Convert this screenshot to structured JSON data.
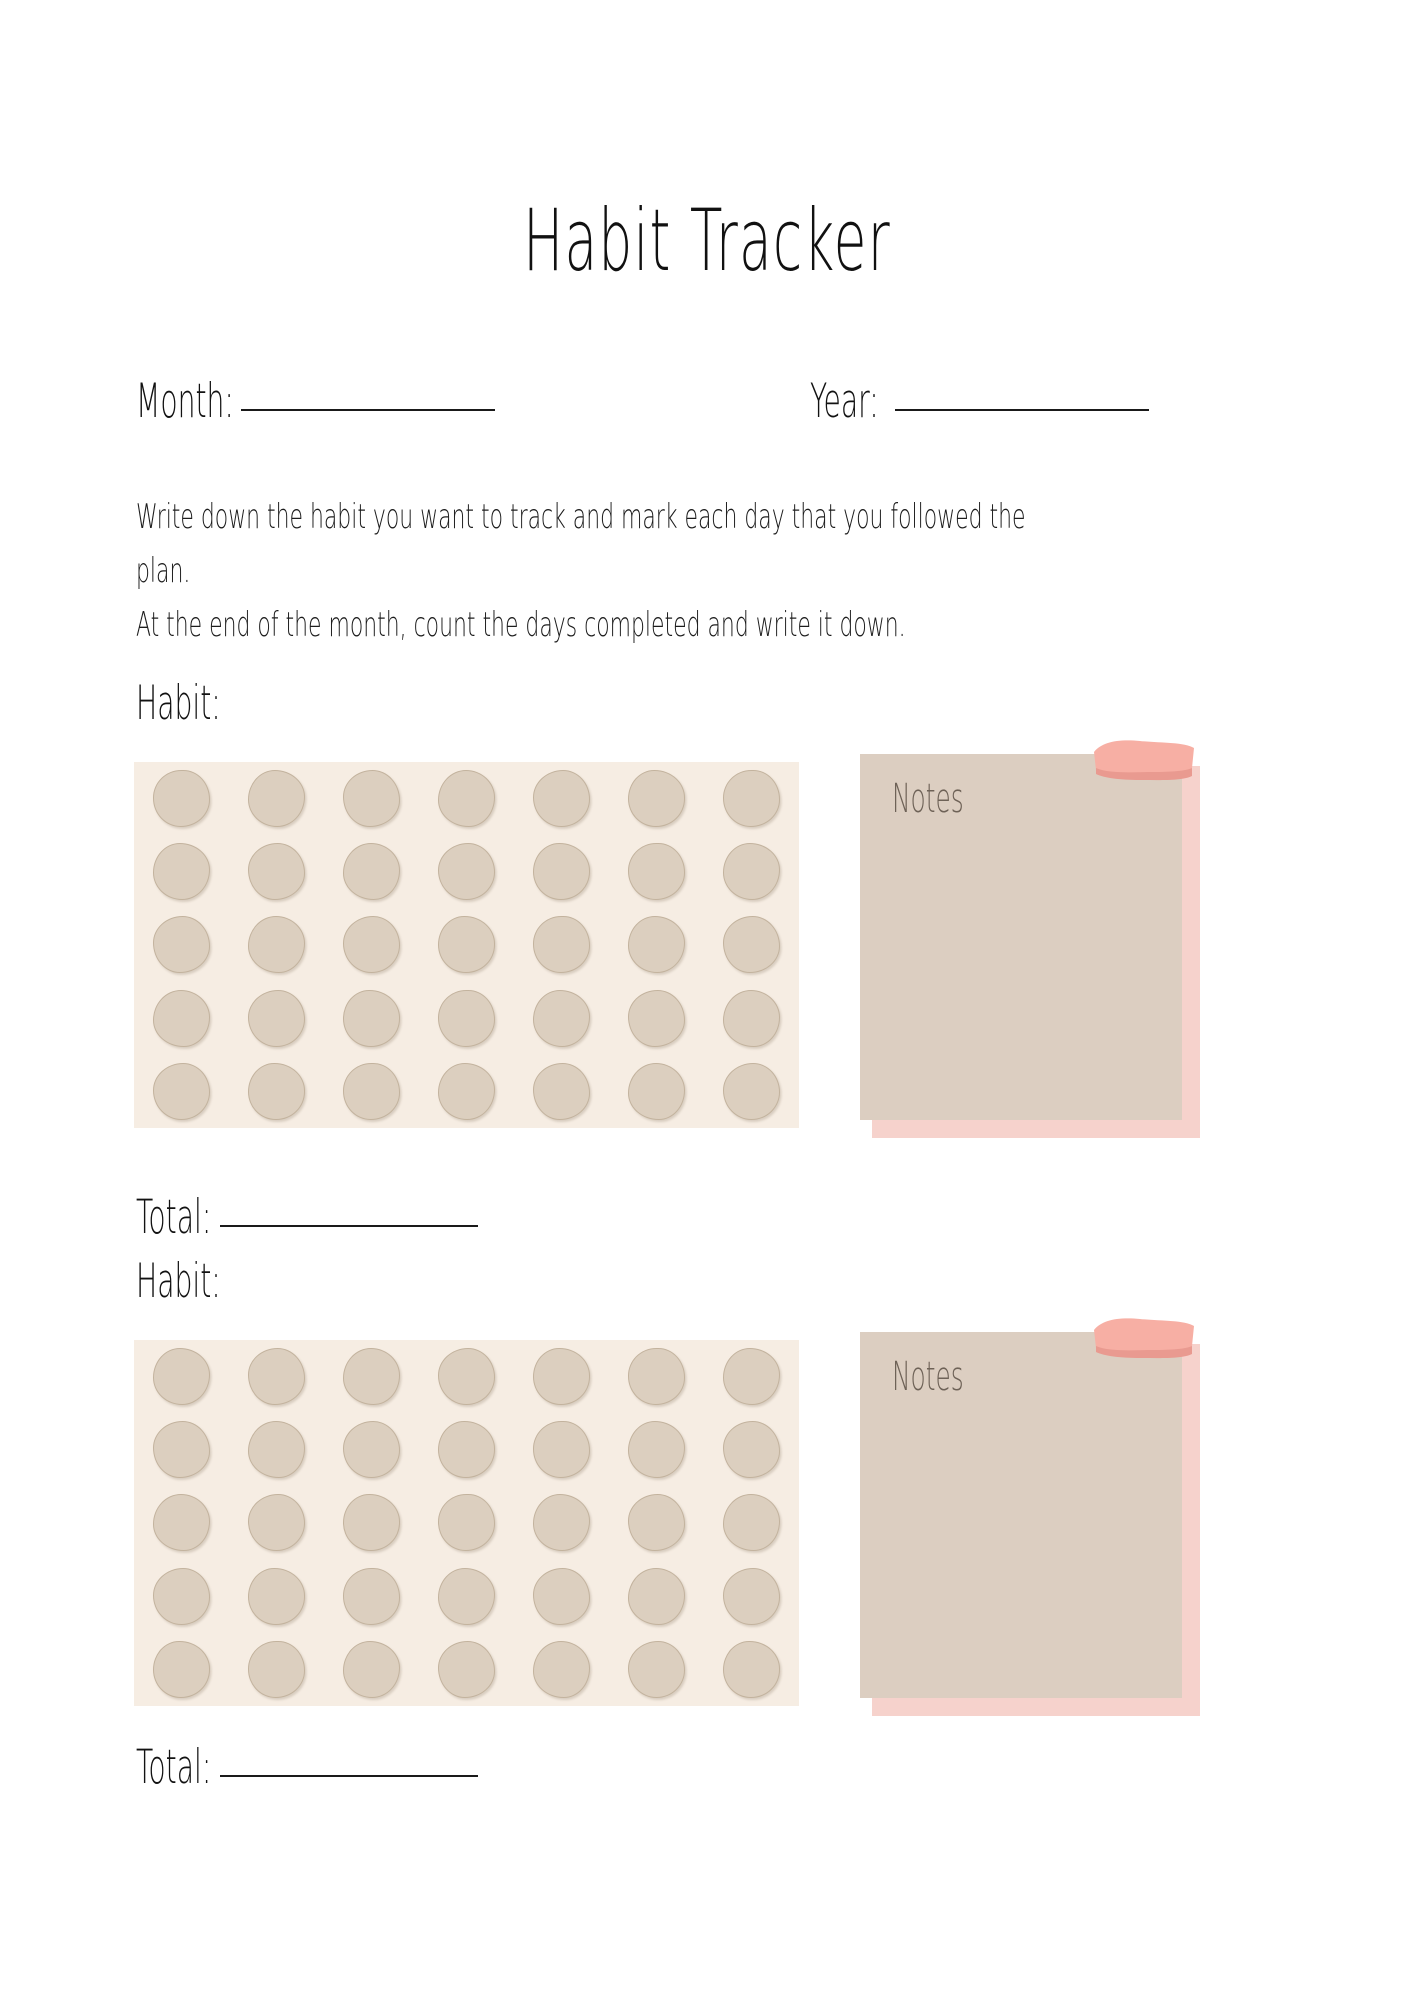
{
  "page": {
    "title": "Habit Tracker",
    "background_color": "#ffffff"
  },
  "fields": {
    "month_label": "Month:",
    "year_label": "Year:"
  },
  "instructions": {
    "line1": "Write down the habit you want to track and mark each day that you followed the",
    "line2": "plan.",
    "line3": "At the end of the month, count the days completed and write it down."
  },
  "sections": [
    {
      "habit_label": "Habit:",
      "total_label": "Total:",
      "notes_label": "Notes",
      "grid": {
        "rows": 5,
        "columns": 7,
        "total_dots": 35
      }
    },
    {
      "habit_label": "Habit:",
      "total_label": "Total:",
      "notes_label": "Notes",
      "grid": {
        "rows": 5,
        "columns": 7,
        "total_dots": 35
      }
    }
  ],
  "colors": {
    "panel_background": "#F6EDE3",
    "dot_fill": "#DCCFBF",
    "dot_outline": "#C3B39E",
    "notes_card": "#DCCEC1",
    "notes_shadow_pink": "#F6D2CC",
    "tape_pink": "#F7AFA4",
    "tape_pink_dark": "#E99A90",
    "text": "#1c1c1c",
    "notes_text": "#6E6257"
  }
}
